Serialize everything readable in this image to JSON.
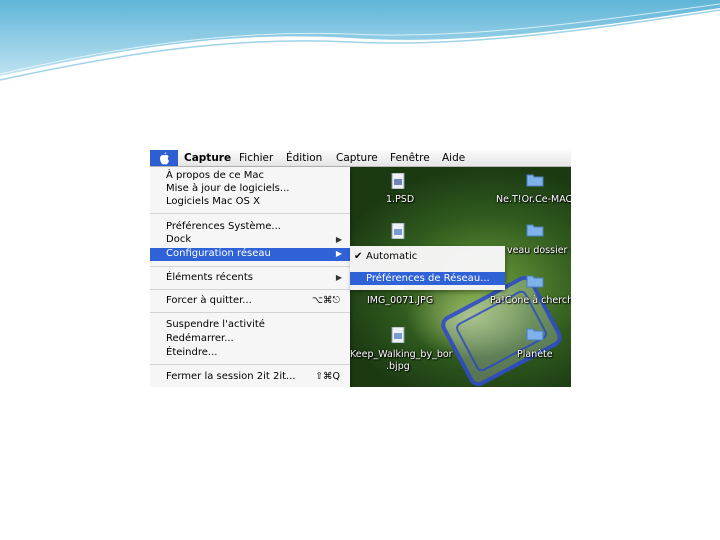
{
  "menubar": {
    "items": [
      "Capture",
      "Fichier",
      "Édition",
      "Capture",
      "Fenêtre",
      "Aide"
    ]
  },
  "apple_menu": {
    "items": [
      {
        "label": "À propos de ce Mac"
      },
      {
        "label": "Mise à jour de logiciels..."
      },
      {
        "label": "Logiciels Mac OS X"
      },
      {
        "label": "Préférences Système..."
      },
      {
        "label": "Dock"
      },
      {
        "label": "Configuration réseau"
      },
      {
        "label": "Éléments récents"
      },
      {
        "label": "Forcer à quitter...",
        "shortcut": "⌥⌘⎋"
      },
      {
        "label": "Suspendre l'activité"
      },
      {
        "label": "Redémarrer..."
      },
      {
        "label": "Éteindre..."
      },
      {
        "label": "Fermer la session 2it 2it...",
        "shortcut": "⇧⌘Q"
      }
    ]
  },
  "submenu": {
    "items": [
      {
        "label": "Automatic",
        "checked": "✔"
      },
      {
        "label": "Préférences de Réseau..."
      }
    ]
  },
  "desktop": {
    "icons": [
      {
        "label": "1.PSD",
        "icon": "psd-file-icon"
      },
      {
        "label": "Ne.T!Or.Ce-MAC",
        "icon": "folder-icon"
      },
      {
        "label": "veau dossier (",
        "icon": "folder-icon"
      },
      {
        "label": "IMG_0071.JPG",
        "icon": "image-file-icon"
      },
      {
        "label": "Pa!Cone à chercher",
        "icon": "folder-icon"
      },
      {
        "label": "Keep_Walking_by_bor",
        "icon": "image-file-icon"
      },
      {
        "label": ".bjpg",
        "icon": ""
      },
      {
        "label": "Planète",
        "icon": "folder-icon"
      }
    ]
  },
  "colors": {
    "highlight": "#2f62d6",
    "apple_box": "#2d5fd3",
    "desktop_green": "#3a6a25"
  }
}
